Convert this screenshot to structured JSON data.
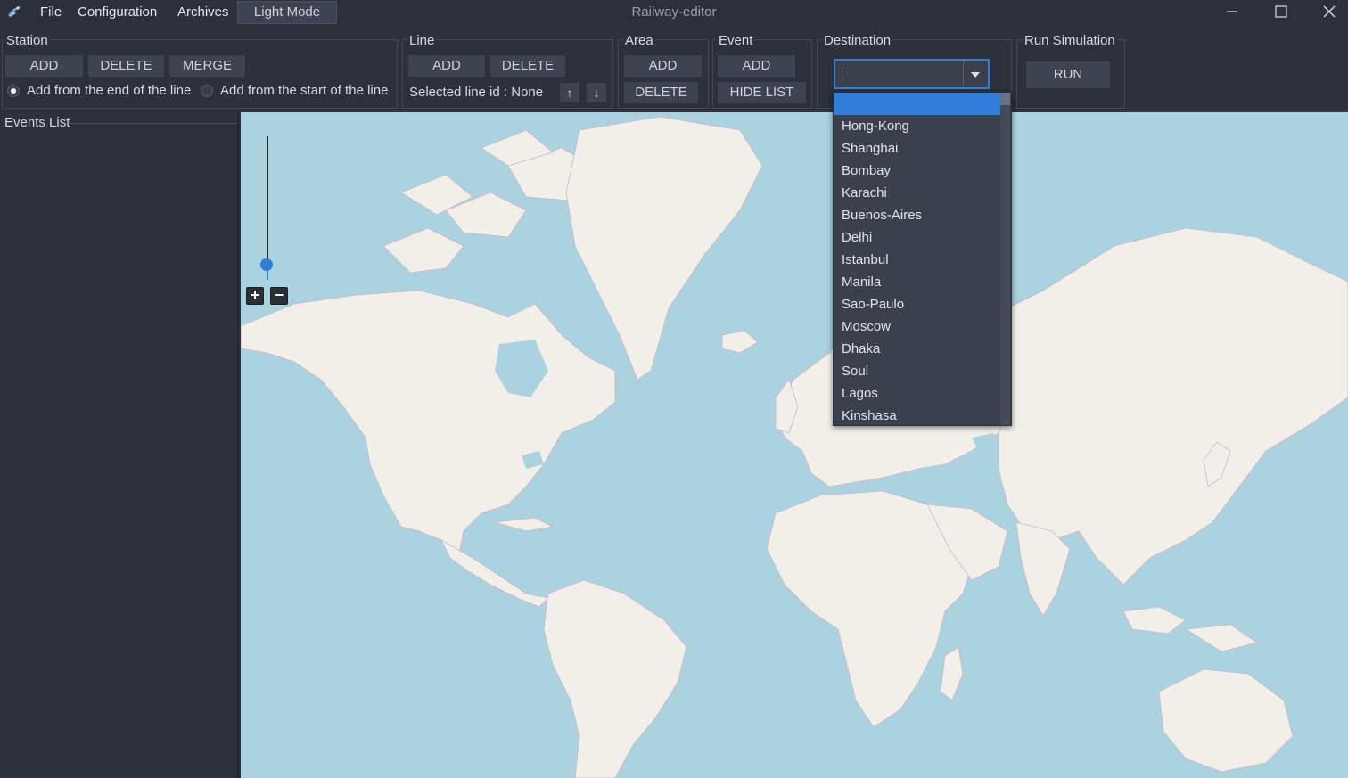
{
  "window": {
    "title": "Railway-editor"
  },
  "menu": {
    "file": "File",
    "configuration": "Configuration",
    "archives": "Archives",
    "light_mode": "Light Mode"
  },
  "station": {
    "title": "Station",
    "add": "ADD",
    "delete": "DELETE",
    "merge": "MERGE",
    "radio_end": "Add from the end of the line",
    "radio_start": "Add from the start of the line"
  },
  "line": {
    "title": "Line",
    "add": "ADD",
    "delete": "DELETE",
    "selected_label": "Selected line id : None",
    "up": "↑",
    "down": "↓"
  },
  "area": {
    "title": "Area",
    "add": "ADD",
    "delete": "DELETE"
  },
  "event": {
    "title": "Event",
    "add": "ADD",
    "hide_list": "HIDE LIST"
  },
  "destination": {
    "title": "Destination",
    "value": "",
    "options": [
      "",
      "Hong-Kong",
      "Shanghai",
      "Bombay",
      "Karachi",
      "Buenos-Aires",
      "Delhi",
      "Istanbul",
      "Manila",
      "Sao-Paulo",
      "Moscow",
      "Dhaka",
      "Soul",
      "Lagos",
      "Kinshasa"
    ]
  },
  "simulation": {
    "title": "Run Simulation",
    "run": "RUN"
  },
  "events_list": {
    "title": "Events List"
  },
  "map": {
    "zoom_in": "+",
    "zoom_out": "−",
    "zoom_level": 0.14
  },
  "colors": {
    "accent": "#2f7ed8",
    "background": "#2c313c",
    "water": "#aad3df",
    "land": "#f2efe9"
  }
}
